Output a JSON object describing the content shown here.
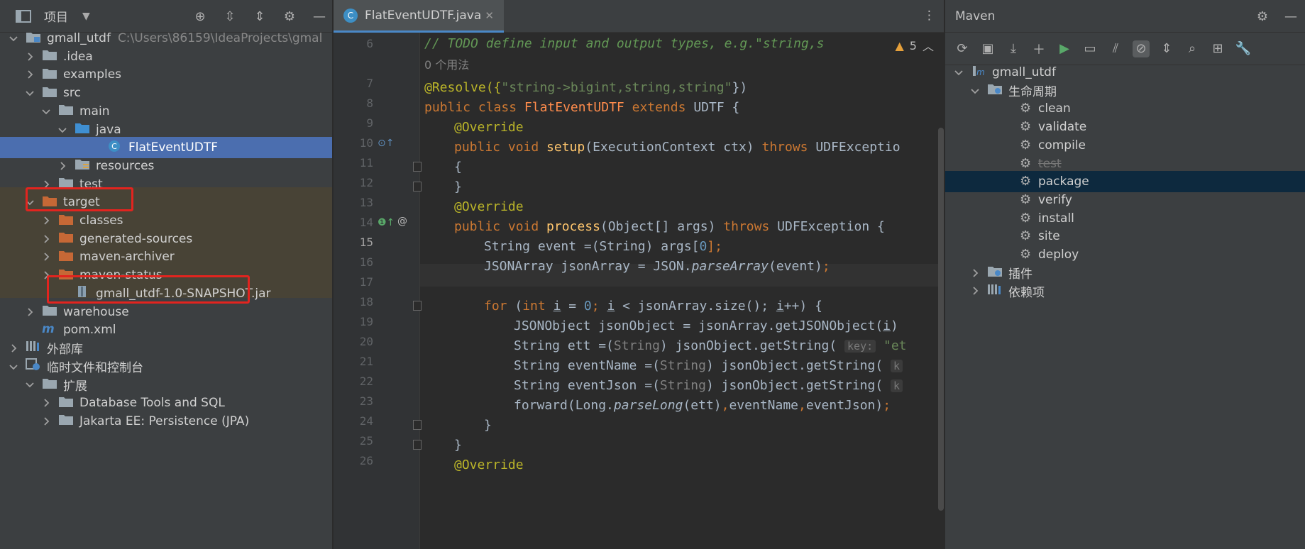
{
  "project": {
    "title": "项目",
    "tree": [
      {
        "label": "gmall_utdf",
        "path": "C:\\Users\\86159\\IdeaProjects\\gmal",
        "indent": 0,
        "arrow": "down",
        "icon": "module"
      },
      {
        "label": ".idea",
        "indent": 1,
        "arrow": "right",
        "icon": "folder"
      },
      {
        "label": "examples",
        "indent": 1,
        "arrow": "right",
        "icon": "folder"
      },
      {
        "label": "src",
        "indent": 1,
        "arrow": "down",
        "icon": "folder"
      },
      {
        "label": "main",
        "indent": 2,
        "arrow": "down",
        "icon": "folder"
      },
      {
        "label": "java",
        "indent": 3,
        "arrow": "down",
        "icon": "folder-blue"
      },
      {
        "label": "FlatEventUDTF",
        "indent": 5,
        "arrow": "",
        "icon": "class"
      },
      {
        "label": "resources",
        "indent": 3,
        "arrow": "right",
        "icon": "folder-res"
      },
      {
        "label": "test",
        "indent": 2,
        "arrow": "right",
        "icon": "folder"
      },
      {
        "label": "target",
        "indent": 1,
        "arrow": "down",
        "icon": "folder-orange"
      },
      {
        "label": "classes",
        "indent": 2,
        "arrow": "right",
        "icon": "folder-orange"
      },
      {
        "label": "generated-sources",
        "indent": 2,
        "arrow": "right",
        "icon": "folder-orange"
      },
      {
        "label": "maven-archiver",
        "indent": 2,
        "arrow": "right",
        "icon": "folder-orange"
      },
      {
        "label": "maven-status",
        "indent": 2,
        "arrow": "right",
        "icon": "folder-orange"
      },
      {
        "label": "gmall_utdf-1.0-SNAPSHOT.jar",
        "indent": 3,
        "arrow": "",
        "icon": "jar"
      },
      {
        "label": "warehouse",
        "indent": 1,
        "arrow": "right",
        "icon": "folder"
      },
      {
        "label": "pom.xml",
        "indent": 1,
        "arrow": "",
        "icon": "maven"
      },
      {
        "label": "外部库",
        "indent": 0,
        "arrow": "right",
        "icon": "lib"
      },
      {
        "label": "临时文件和控制台",
        "indent": 0,
        "arrow": "down",
        "icon": "scratch"
      },
      {
        "label": "扩展",
        "indent": 1,
        "arrow": "down",
        "icon": "folder"
      },
      {
        "label": "Database Tools and SQL",
        "indent": 2,
        "arrow": "right",
        "icon": "folder"
      },
      {
        "label": "Jakarta EE: Persistence (JPA)",
        "indent": 2,
        "arrow": "right",
        "icon": "folder"
      }
    ]
  },
  "editor": {
    "tab_label": "FlatEventUDTF.java",
    "line_numbers": [
      "6",
      "7",
      "8",
      "9",
      "10",
      "11",
      "12",
      "13",
      "14",
      "15",
      "16",
      "17",
      "18",
      "19",
      "20",
      "21",
      "22",
      "23",
      "24",
      "25",
      "26"
    ],
    "warning_count": "5",
    "usages": "0 个用法",
    "lines": {
      "l6": "// TODO define input and output types, e.g.\"string,s",
      "l7a": "@Resolve({",
      "l7b": "\"string->bigint,string,string\"",
      "l7c": "})",
      "l8a": "public class ",
      "l8b": "FlatEventUDTF ",
      "l8c": "extends ",
      "l8d": "UDTF {",
      "l9": "@Override",
      "l10a": "public void ",
      "l10b": "setup",
      "l10c": "(ExecutionContext ctx) ",
      "l10d": "throws ",
      "l10e": "UDFExceptio",
      "l11": "{",
      "l12": "}",
      "l13": "@Override",
      "l14a": "public void ",
      "l14b": "process",
      "l14c": "(Object[] args) ",
      "l14d": "throws ",
      "l14e": "UDFException {",
      "l15a": "String event =(String) args[",
      "l15b": "0",
      "l15c": "];",
      "l16a": "JSONArray jsonArray = JSON.",
      "l16b": "parseArray",
      "l16c": "(event)",
      "l16d": ";",
      "l18a": "for ",
      "l18b": "(",
      "l18c": "int ",
      "l18d": "i",
      "l18e": " = ",
      "l18f": "0",
      "l18g": "; ",
      "l18h": "i",
      "l18i": " < jsonArray.size(); ",
      "l18j": "i",
      "l18k": "++) {",
      "l19a": "JSONObject jsonObject = jsonArray.getJSONObject(",
      "l19b": "i",
      "l19c": ")",
      "l20a": "String ett =(",
      "l20b": "String",
      "l20c": ") jsonObject.getString( ",
      "l20d": "key:",
      "l20e": " \"et",
      "l21a": "String eventName =(",
      "l21b": "String",
      "l21c": ") jsonObject.getString( ",
      "l21d": "k",
      "l22a": "String eventJson =(",
      "l22b": "String",
      "l22c": ") jsonObject.getString( ",
      "l22d": "k",
      "l23a": "forward(Long.",
      "l23b": "parseLong",
      "l23c": "(ett)",
      "l23d": ",",
      "l23e": "eventName",
      "l23f": ",",
      "l23g": "eventJson)",
      "l23h": ";",
      "l24": "}",
      "l25": "}",
      "l26": "@Override"
    }
  },
  "maven": {
    "title": "Maven",
    "project": "gmall_utdf",
    "lifecycle_label": "生命周期",
    "goals": [
      "clean",
      "validate",
      "compile",
      "test",
      "package",
      "verify",
      "install",
      "site",
      "deploy"
    ],
    "plugins_label": "插件",
    "deps_label": "依赖项"
  }
}
